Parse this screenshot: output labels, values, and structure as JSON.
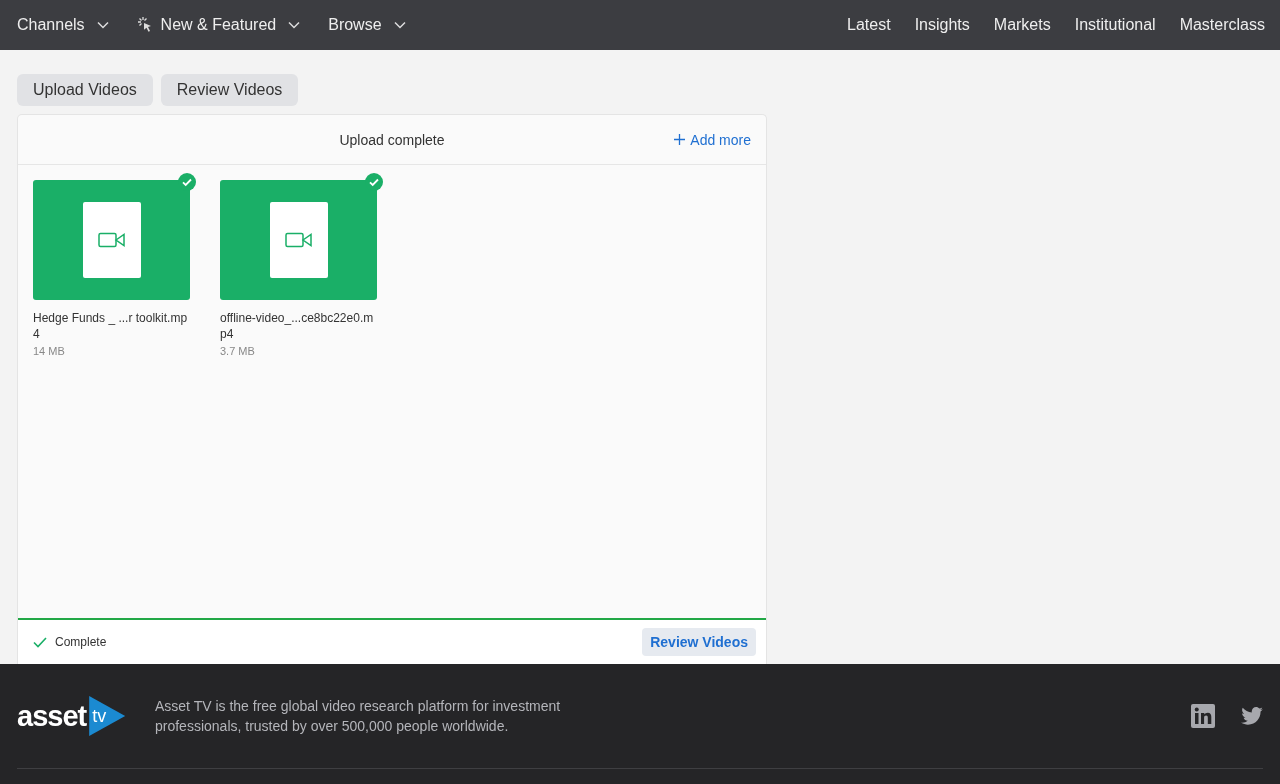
{
  "nav": {
    "left": [
      {
        "label": "Channels",
        "icon": false
      },
      {
        "label": "New & Featured",
        "icon": true
      },
      {
        "label": "Browse",
        "icon": false
      }
    ],
    "right": [
      "Latest",
      "Insights",
      "Markets",
      "Institutional",
      "Masterclass"
    ]
  },
  "tabs": [
    "Upload Videos",
    "Review Videos"
  ],
  "uploader": {
    "title": "Upload complete",
    "add_more": "Add more",
    "files": [
      {
        "name": "Hedge Funds _ ...r toolkit.mp4",
        "size": "14 MB",
        "done": true
      },
      {
        "name": "offline-video_...ce8bc22e0.mp4",
        "size": "3.7 MB",
        "done": true
      }
    ],
    "progress": {
      "level": 1
    },
    "status": "Complete",
    "button": "Review Videos"
  },
  "footer": {
    "logo": {
      "word": "asset",
      "mark": "tv"
    },
    "text": "Asset TV is the free global video research platform for investment professionals, trusted by over 500,000 people worldwide."
  }
}
